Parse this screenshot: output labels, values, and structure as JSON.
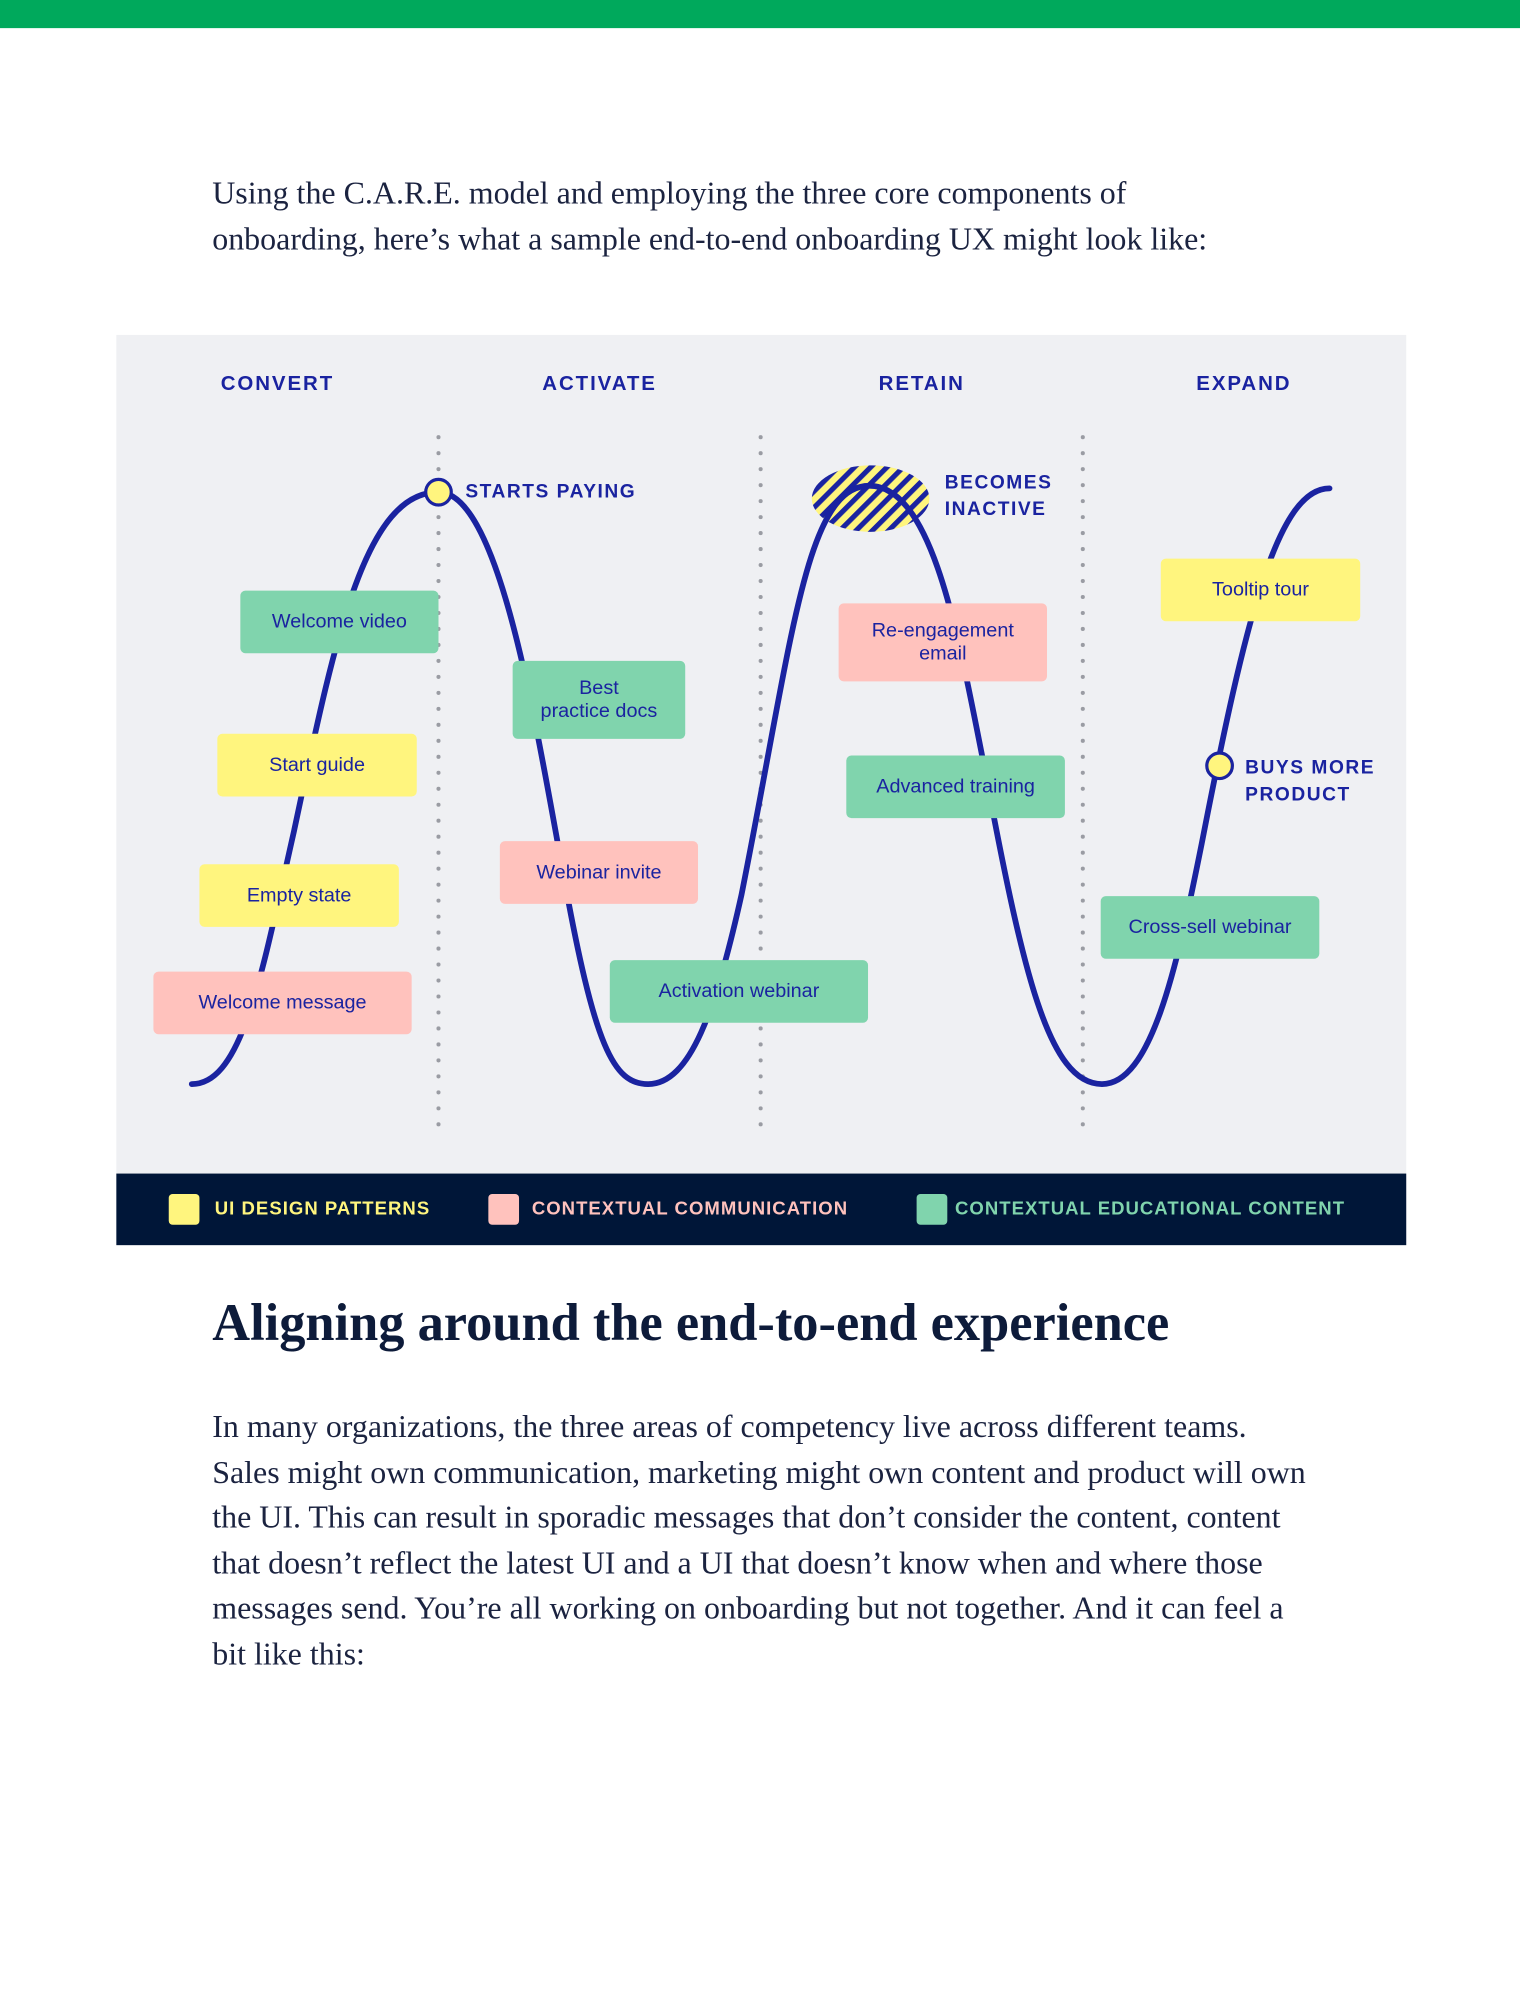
{
  "intro": "Using the C.A.R.E. model and employing the three core components of onboarding, here’s what a sample end-to-end onboarding UX might look like:",
  "diagram": {
    "phases": [
      "CONVERT",
      "ACTIVATE",
      "RETAIN",
      "EXPAND"
    ],
    "milestones": {
      "starts_paying": "STARTS PAYING",
      "becomes_inactive": [
        "BECOMES",
        "INACTIVE"
      ],
      "buys_more": [
        "BUYS MORE",
        "PRODUCT"
      ]
    },
    "items": {
      "welcome_video": "Welcome video",
      "start_guide": "Start guide",
      "empty_state": "Empty state",
      "welcome_message": "Welcome message",
      "best_practice_docs": [
        "Best",
        "practice docs"
      ],
      "webinar_invite": "Webinar invite",
      "activation_webinar": "Activation webinar",
      "reengagement_email": [
        "Re-engagement",
        "email"
      ],
      "advanced_training": "Advanced training",
      "tooltip_tour": "Tooltip tour",
      "cross_sell_webinar": "Cross-sell webinar"
    },
    "legend": [
      {
        "label": "UI DESIGN PATTERNS",
        "color": "#fff57e"
      },
      {
        "label": "CONTEXTUAL COMMUNICATION",
        "color": "#ffc2bd"
      },
      {
        "label": "CONTEXTUAL EDUCATIONAL CONTENT",
        "color": "#80d4ad"
      }
    ],
    "colors": {
      "curve": "#1a23a0",
      "panel": "#eff0f3",
      "legend_bg": "#001638",
      "accent_bar": "#00a95c"
    }
  },
  "heading": "Aligning around the end-to-end experience",
  "body": "In many organizations, the three areas of competency live across different teams. Sales might own communication, marketing might own content and product will own the UI. This can result in sporadic messages that don’t consider the content, content that doesn’t reflect the latest UI and a UI that doesn’t know when and where those messages send. You’re all working on onboarding but not together. And it can feel a bit like this:"
}
